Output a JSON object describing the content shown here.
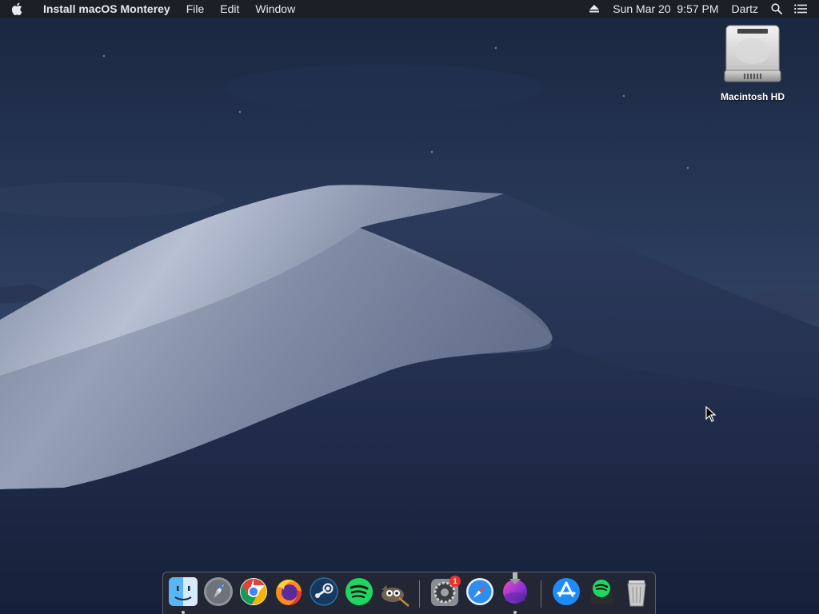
{
  "menubar": {
    "app_name": "Install macOS Monterey",
    "menus": [
      "File",
      "Edit",
      "Window"
    ],
    "datetime": "Sun Mar 20  9:57 PM",
    "user": "Dartz"
  },
  "desktop": {
    "icons": [
      {
        "label": "Macintosh HD",
        "icon": "hard-drive-icon"
      }
    ]
  },
  "dock": {
    "items": [
      {
        "name": "finder",
        "icon": "finder-icon",
        "running": true
      },
      {
        "name": "launchpad",
        "icon": "launchpad-icon",
        "running": false
      },
      {
        "name": "chrome",
        "icon": "chrome-icon",
        "running": false
      },
      {
        "name": "firefox",
        "icon": "firefox-icon",
        "running": false
      },
      {
        "name": "steam",
        "icon": "steam-icon",
        "running": false
      },
      {
        "name": "spotify",
        "icon": "spotify-icon",
        "running": false
      },
      {
        "name": "gimp",
        "icon": "gimp-icon",
        "running": false
      },
      {
        "name": "system-preferences",
        "icon": "system-preferences-icon",
        "running": false,
        "badge": "1"
      },
      {
        "name": "safari",
        "icon": "safari-icon",
        "running": false
      },
      {
        "name": "install-macos-monterey",
        "icon": "monterey-installer-icon",
        "running": true
      },
      {
        "name": "app-store",
        "icon": "app-store-icon",
        "running": false
      },
      {
        "name": "spotify-installer",
        "icon": "spotify-installer-icon",
        "running": false
      },
      {
        "name": "trash",
        "icon": "trash-icon",
        "running": false
      }
    ]
  },
  "colors": {
    "menubar_bg": "#1c1e24",
    "sky_top": "#1e2c46",
    "sky_bottom": "#3b4b6c",
    "dune_light": "#a9b3c8",
    "dune_dark": "#1f2b49",
    "badge": "#e8332e"
  }
}
